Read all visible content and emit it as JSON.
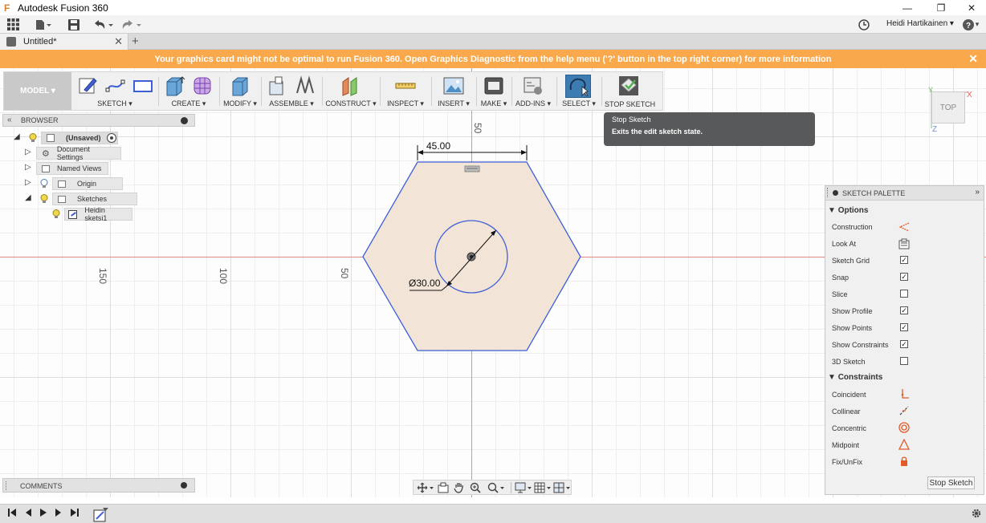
{
  "app": {
    "title": "Autodesk Fusion 360",
    "user": "Heidi Hartikainen ▾",
    "help": "?"
  },
  "document": {
    "tab_title": "Untitled*"
  },
  "banner": {
    "text": "Your graphics card might not be optimal to run Fusion 360. Open Graphics Diagnostic from the help menu ('?' button in the top right corner) for more information"
  },
  "toolbar": {
    "workspace": "MODEL ▾",
    "groups": [
      "SKETCH ▾",
      "CREATE ▾",
      "MODIFY ▾",
      "ASSEMBLE ▾",
      "CONSTRUCT ▾",
      "INSPECT ▾",
      "INSERT ▾",
      "MAKE ▾",
      "ADD-INS ▾",
      "SELECT ▾",
      "STOP SKETCH"
    ]
  },
  "browser": {
    "title": "BROWSER",
    "root": "(Unsaved)",
    "items": [
      "Document Settings",
      "Named Views",
      "Origin",
      "Sketches",
      "Heidin sketsi1"
    ]
  },
  "canvas": {
    "ruler_labels": [
      "150",
      "100",
      "50",
      "50"
    ],
    "dimension_width": "45.00",
    "dimension_diameter": "Ø30.00"
  },
  "viewcube": {
    "label": "TOP",
    "axis_x": "X",
    "axis_y": "Y",
    "axis_z": "Z"
  },
  "tooltip": {
    "title": "Stop Sketch",
    "description": "Exits the edit sketch state."
  },
  "palette": {
    "title": "SKETCH PALETTE",
    "options_label": "Options",
    "options": [
      {
        "label": "Construction",
        "type": "icon",
        "icon": "construction-icon"
      },
      {
        "label": "Look At",
        "type": "icon",
        "icon": "look-at-icon"
      },
      {
        "label": "Sketch Grid",
        "type": "check",
        "checked": "✓"
      },
      {
        "label": "Snap",
        "type": "check",
        "checked": "✓"
      },
      {
        "label": "Slice",
        "type": "check",
        "checked": ""
      },
      {
        "label": "Show Profile",
        "type": "check",
        "checked": "✓"
      },
      {
        "label": "Show Points",
        "type": "check",
        "checked": "✓"
      },
      {
        "label": "Show Constraints",
        "type": "check",
        "checked": "✓"
      },
      {
        "label": "3D Sketch",
        "type": "check",
        "checked": ""
      }
    ],
    "constraints_label": "Constraints",
    "constraints": [
      {
        "label": "Coincident",
        "icon": "coincident-icon"
      },
      {
        "label": "Collinear",
        "icon": "collinear-icon"
      },
      {
        "label": "Concentric",
        "icon": "concentric-icon"
      },
      {
        "label": "Midpoint",
        "icon": "midpoint-icon"
      },
      {
        "label": "Fix/UnFix",
        "icon": "fix-icon"
      }
    ],
    "stop_button": "Stop Sketch"
  },
  "comments": {
    "title": "COMMENTS"
  },
  "colors": {
    "banner": "#f9a94b",
    "sketch_line": "#3f5fd6",
    "profile_fill": "#f2e4d6",
    "accent": "#2f6fb0"
  }
}
